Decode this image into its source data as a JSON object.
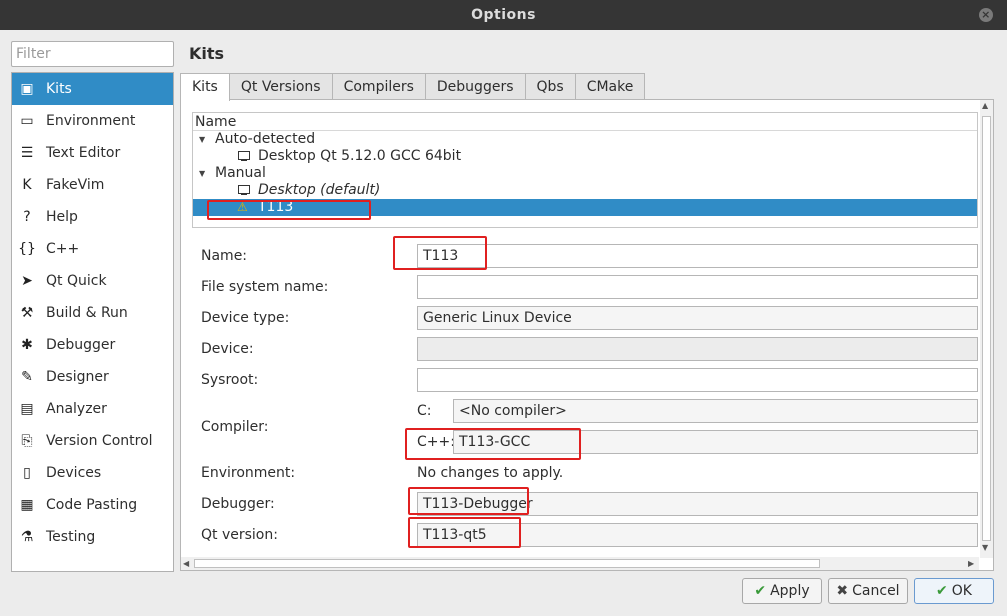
{
  "window": {
    "title": "Options",
    "close_icon": "×"
  },
  "filter": {
    "placeholder": "Filter"
  },
  "categories": [
    {
      "label": "Kits",
      "icon": "kits-icon",
      "glyph": "▣",
      "selected": true
    },
    {
      "label": "Environment",
      "icon": "monitor-icon",
      "glyph": "▭"
    },
    {
      "label": "Text Editor",
      "icon": "text-editor-icon",
      "glyph": "☰"
    },
    {
      "label": "FakeVim",
      "icon": "fakevim-icon",
      "glyph": "K"
    },
    {
      "label": "Help",
      "icon": "help-icon",
      "glyph": "?"
    },
    {
      "label": "C++",
      "icon": "cpp-icon",
      "glyph": "{}"
    },
    {
      "label": "Qt Quick",
      "icon": "qt-quick-icon",
      "glyph": "➤"
    },
    {
      "label": "Build & Run",
      "icon": "hammer-icon",
      "glyph": "⚒"
    },
    {
      "label": "Debugger",
      "icon": "bug-icon",
      "glyph": "✱"
    },
    {
      "label": "Designer",
      "icon": "pencil-icon",
      "glyph": "✎"
    },
    {
      "label": "Analyzer",
      "icon": "analyzer-icon",
      "glyph": "▤"
    },
    {
      "label": "Version Control",
      "icon": "version-control-icon",
      "glyph": "⎘"
    },
    {
      "label": "Devices",
      "icon": "devices-icon",
      "glyph": "▯"
    },
    {
      "label": "Code Pasting",
      "icon": "code-pasting-icon",
      "glyph": "▦"
    },
    {
      "label": "Testing",
      "icon": "testing-icon",
      "glyph": "⚗"
    }
  ],
  "page_title": "Kits",
  "tabs": [
    "Kits",
    "Qt Versions",
    "Compilers",
    "Debuggers",
    "Qbs",
    "CMake"
  ],
  "tree": {
    "header": "Name",
    "rows": [
      {
        "label": "Auto-detected",
        "type": "group"
      },
      {
        "label": "Desktop Qt 5.12.0 GCC 64bit",
        "type": "kit",
        "icon": "monitor-icon"
      },
      {
        "label": "Manual",
        "type": "group"
      },
      {
        "label": "Desktop (default)",
        "type": "kit",
        "icon": "monitor-icon",
        "italic": true
      },
      {
        "label": "T113",
        "type": "kit",
        "icon": "warning-icon",
        "selected": true
      }
    ]
  },
  "form": {
    "name_label": "Name:",
    "name_value": "T113",
    "fs_name_label": "File system name:",
    "fs_name_value": "",
    "device_type_label": "Device type:",
    "device_type_value": "Generic Linux Device",
    "device_label": "Device:",
    "device_value": "",
    "sysroot_label": "Sysroot:",
    "sysroot_value": "",
    "compiler_label": "Compiler:",
    "compiler_c_label": "C:",
    "compiler_c_value": "<No compiler>",
    "compiler_cpp_label": "C++:",
    "compiler_cpp_value": "T113-GCC",
    "environment_label": "Environment:",
    "environment_value": "No changes to apply.",
    "debugger_label": "Debugger:",
    "debugger_value": "T113-Debugger",
    "qt_version_label": "Qt version:",
    "qt_version_value": "T113-qt5"
  },
  "buttons": {
    "apply": "Apply",
    "cancel": "Cancel",
    "ok": "OK"
  },
  "colors": {
    "selection": "#308cc6",
    "highlight_box": "#e02020",
    "titlebar": "#353535"
  }
}
